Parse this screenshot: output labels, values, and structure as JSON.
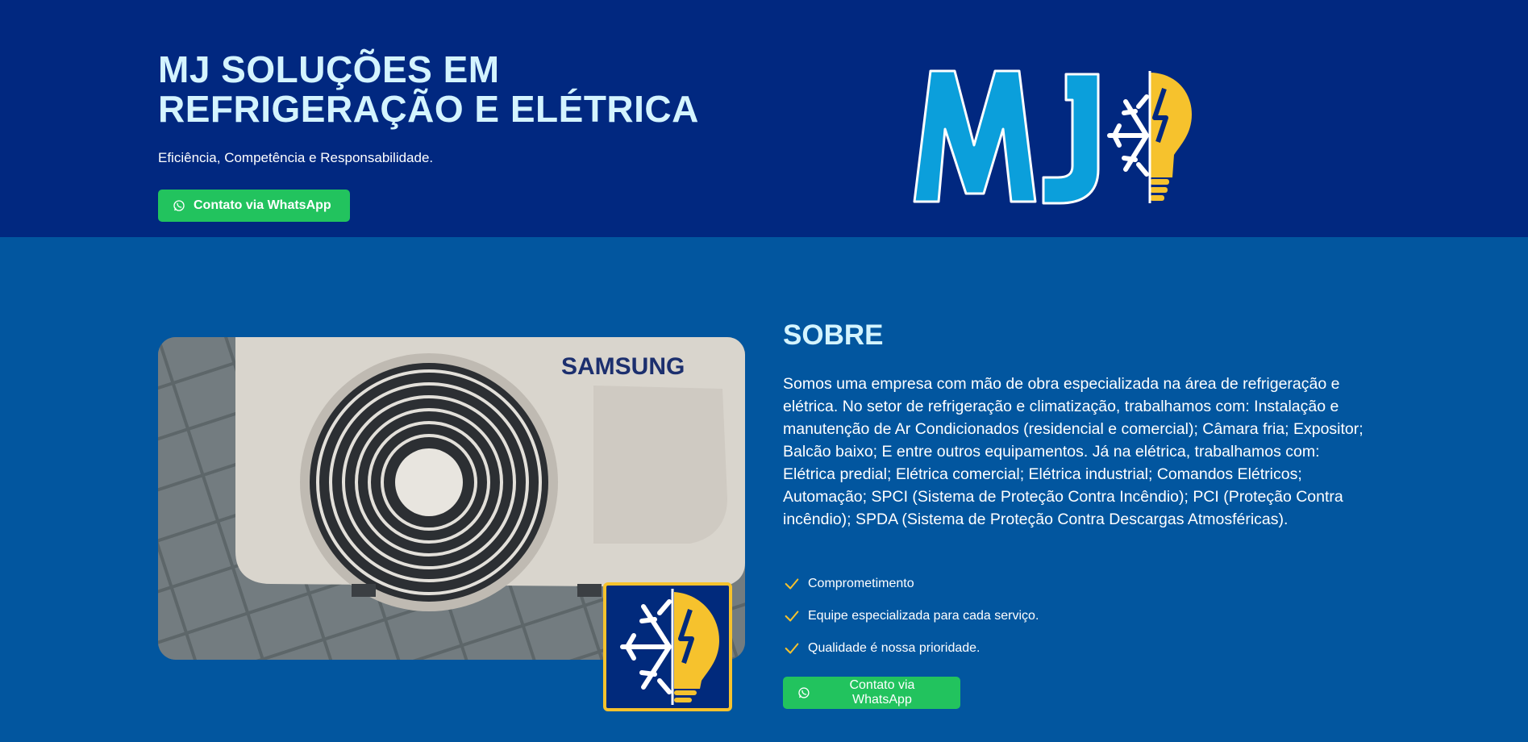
{
  "hero": {
    "title_line1": "MJ SOLUÇÕES EM",
    "title_line2": "REFRIGERAÇÃO E ELÉTRICA",
    "subtitle": "Eficiência, Competência e Responsabilidade.",
    "cta_label": "Contato via WhatsApp",
    "logo_text": "MJ"
  },
  "about": {
    "title": "SOBRE",
    "description": "Somos uma empresa com mão de obra especializada na área de refrigeração e elétrica. No setor de refrigeração e climatização, trabalhamos com: Instalação e manutenção de Ar Condicionados (residencial e comercial); Câmara fria; Expositor; Balcão baixo; E entre outros equipamentos. Já na elétrica, trabalhamos com: Elétrica predial; Elétrica comercial; Elétrica industrial; Comandos Elétricos; Automação; SPCI (Sistema de Proteção Contra Incêndio); PCI (Proteção Contra incêndio); SPDA (Sistema de Proteção Contra Descargas Atmosféricas).",
    "features": [
      "Comprometimento",
      "Equipe especializada para cada serviço.",
      "Qualidade é nossa prioridade."
    ],
    "cta_label": "Contato via WhatsApp",
    "photo_brand": "SAMSUNG"
  },
  "colors": {
    "hero_bg": "#012880",
    "about_bg": "#02569f",
    "title": "#d4f4ff",
    "whatsapp": "#22c35e",
    "logo_blue": "#0b9fdb",
    "logo_yellow": "#f6c22d"
  },
  "icons": [
    "whatsapp-icon",
    "check-icon",
    "snowflake-icon",
    "lightning-bulb-icon"
  ]
}
